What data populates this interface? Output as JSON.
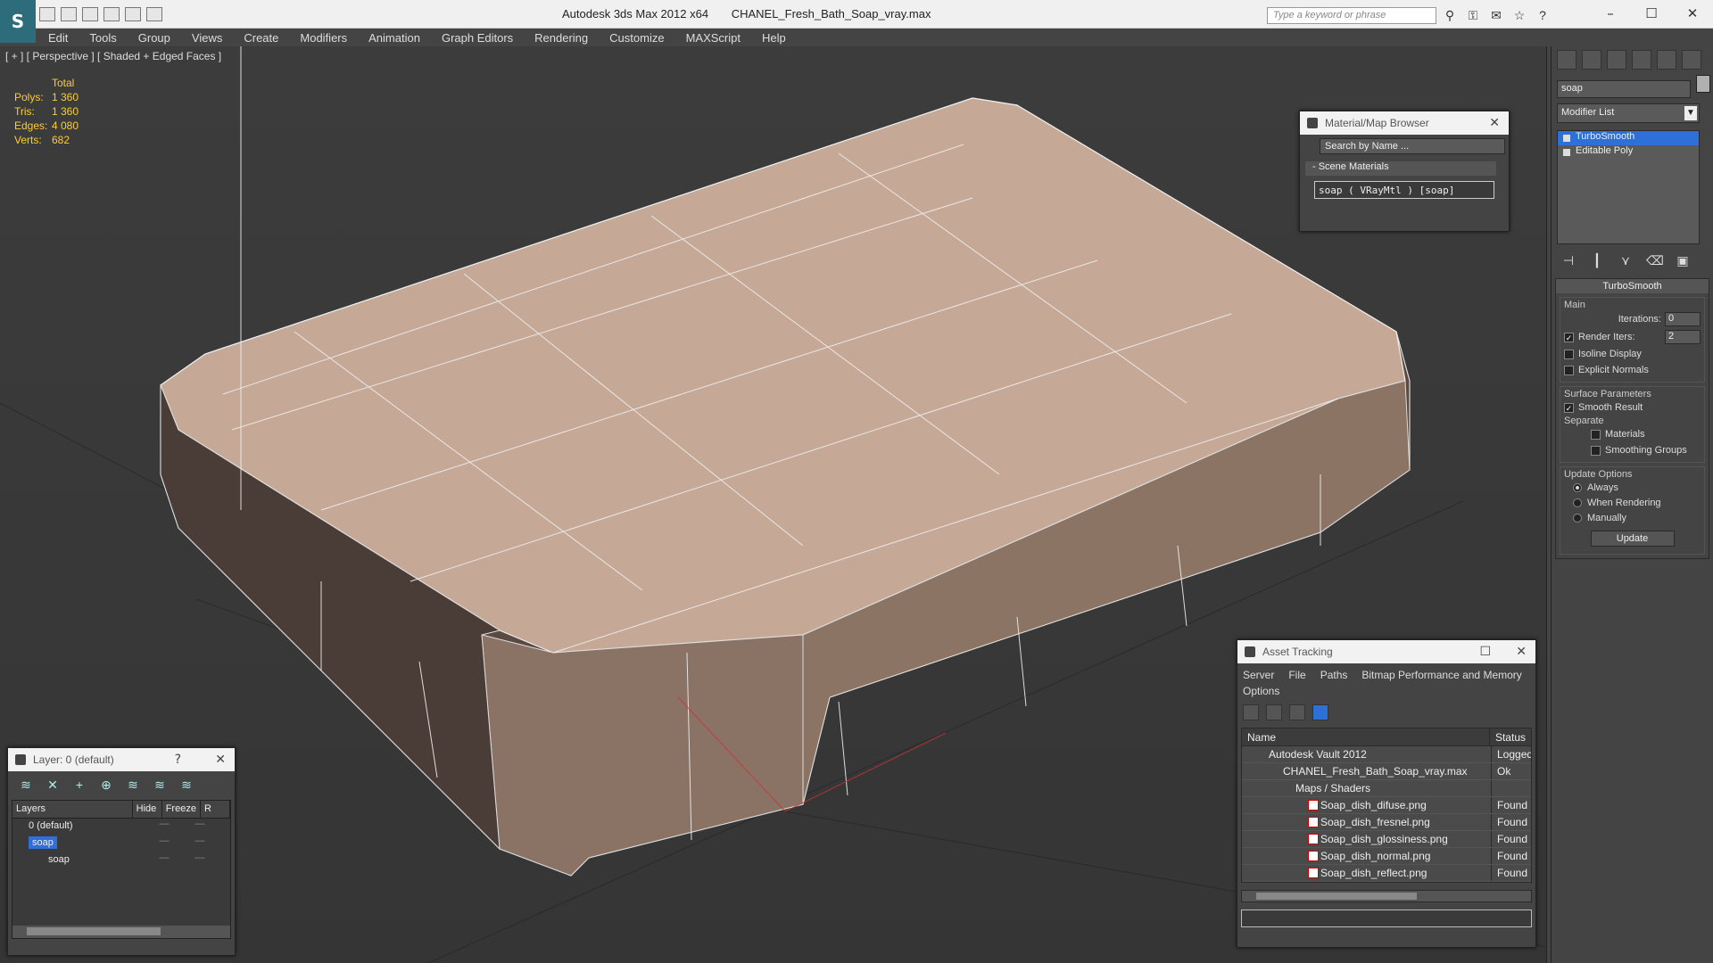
{
  "titlebar": {
    "app_name": "Autodesk 3ds Max  2012 x64",
    "file_name": "CHANEL_Fresh_Bath_Soap_vray.max",
    "search_placeholder": "Type a keyword or phrase",
    "logo_glyph": "S"
  },
  "menu": [
    "Edit",
    "Tools",
    "Group",
    "Views",
    "Create",
    "Modifiers",
    "Animation",
    "Graph Editors",
    "Rendering",
    "Customize",
    "MAXScript",
    "Help"
  ],
  "viewport": {
    "label": "[ + ] [ Perspective ] [ Shaded + Edged Faces ]",
    "stats_header": "Total",
    "stats": [
      {
        "k": "Polys:",
        "v": "1 360"
      },
      {
        "k": "Tris:",
        "v": "1 360"
      },
      {
        "k": "Edges:",
        "v": "4 080"
      },
      {
        "k": "Verts:",
        "v": "682"
      }
    ]
  },
  "command_panel": {
    "object_name": "soap",
    "modifier_list": "Modifier List",
    "stack": [
      "TurboSmooth",
      "Editable Poly"
    ],
    "rollout_title": "TurboSmooth",
    "main_group": "Main",
    "iterations_label": "Iterations:",
    "iterations_value": "0",
    "render_iters_label": "Render Iters:",
    "render_iters_value": "2",
    "isoline": "Isoline Display",
    "explicit_normals": "Explicit Normals",
    "surface_group": "Surface Parameters",
    "smooth_result": "Smooth Result",
    "separate": "Separate",
    "materials": "Materials",
    "smoothing_groups": "Smoothing Groups",
    "update_group": "Update Options",
    "always": "Always",
    "when_rendering": "When Rendering",
    "manually": "Manually",
    "update_button": "Update"
  },
  "material_browser": {
    "title": "Material/Map Browser",
    "search_placeholder": "Search by Name ...",
    "section": "- Scene Materials",
    "item": "soap  ( VRayMtl ) [soap]"
  },
  "asset_tracking": {
    "title": "Asset Tracking",
    "menu": [
      "Server",
      "File",
      "Paths",
      "Bitmap Performance and Memory"
    ],
    "submenu": "Options",
    "col_name": "Name",
    "col_status": "Status",
    "rows": [
      {
        "name": "Autodesk Vault 2012",
        "status": "Logged O"
      },
      {
        "name": "CHANEL_Fresh_Bath_Soap_vray.max",
        "status": "Ok"
      },
      {
        "name": "Maps / Shaders",
        "status": ""
      },
      {
        "name": "Soap_dish_difuse.png",
        "status": "Found"
      },
      {
        "name": "Soap_dish_fresnel.png",
        "status": "Found"
      },
      {
        "name": "Soap_dish_glossiness.png",
        "status": "Found"
      },
      {
        "name": "Soap_dish_normal.png",
        "status": "Found"
      },
      {
        "name": "Soap_dish_reflect.png",
        "status": "Found"
      }
    ]
  },
  "layers": {
    "title": "Layer: 0 (default)",
    "col_layers": "Layers",
    "col_hide": "Hide",
    "col_freeze": "Freeze",
    "col_r": "R",
    "rows": [
      "0 (default)",
      "soap",
      "soap"
    ]
  }
}
